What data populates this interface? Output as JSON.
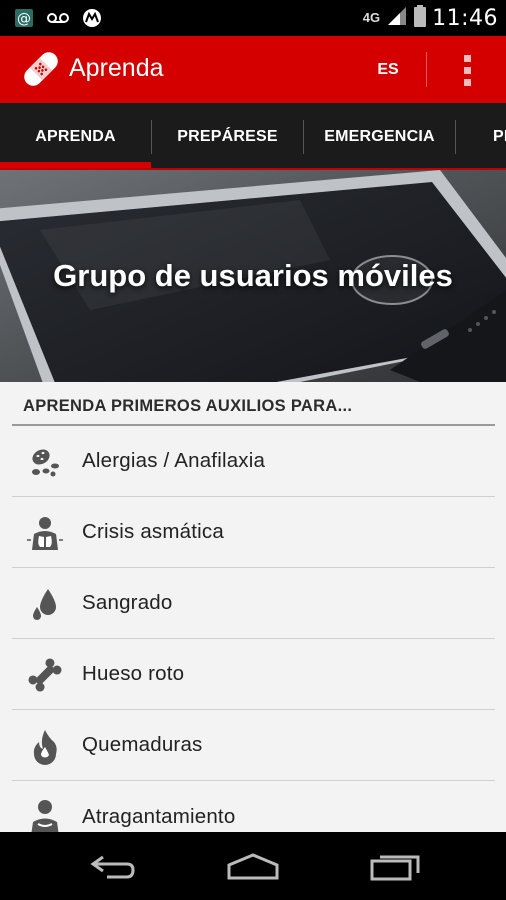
{
  "status_bar": {
    "time": "11:46",
    "network": "4G",
    "icons": [
      "email-icon",
      "voicemail-icon",
      "motorola-icon",
      "signal-icon",
      "battery-icon"
    ]
  },
  "app_bar": {
    "title": "Aprenda",
    "language": "ES",
    "colors": {
      "primary": "#d40000"
    }
  },
  "tabs": [
    {
      "label": "APRENDA",
      "active": true
    },
    {
      "label": "PREPÁRESE",
      "active": false
    },
    {
      "label": "EMERGENCIA",
      "active": false
    },
    {
      "label": "PR",
      "active": false
    }
  ],
  "hero": {
    "title": "Grupo de usuarios móviles"
  },
  "section": {
    "header": "APRENDA PRIMEROS AUXILIOS PARA...",
    "items": [
      {
        "label": "Alergias / Anafilaxia",
        "icon": "allergy-icon"
      },
      {
        "label": "Crisis asmática",
        "icon": "lungs-icon"
      },
      {
        "label": "Sangrado",
        "icon": "blood-drop-icon"
      },
      {
        "label": "Hueso roto",
        "icon": "bone-icon"
      },
      {
        "label": "Quemaduras",
        "icon": "flame-icon"
      },
      {
        "label": "Atragantamiento",
        "icon": "choking-icon"
      }
    ]
  },
  "nav_bar": {
    "icons": [
      "back-icon",
      "home-icon",
      "recent-apps-icon"
    ]
  }
}
